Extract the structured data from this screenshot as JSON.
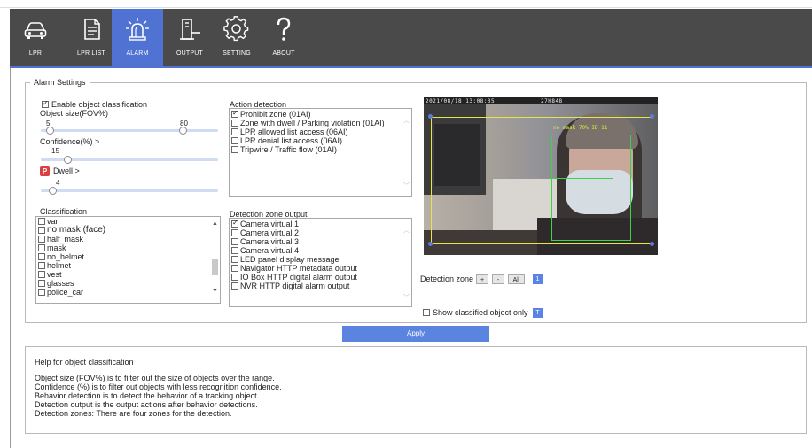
{
  "nav": {
    "items": [
      {
        "label": "LPR",
        "icon": "car-icon"
      },
      {
        "label": "LPR LIST",
        "icon": "document-icon"
      },
      {
        "label": "ALARM",
        "icon": "alarm-siren-icon"
      },
      {
        "label": "OUTPUT",
        "icon": "output-plug-icon"
      },
      {
        "label": "SETTING",
        "icon": "gear-icon"
      },
      {
        "label": "ABOUT",
        "icon": "question-icon"
      }
    ],
    "active": "ALARM",
    "accent": "#4f72d3"
  },
  "alarm": {
    "legend": "Alarm Settings",
    "enable_label": "Enable object classification",
    "enable_checked": true,
    "object_size_label": "Object size(FOV%)",
    "object_size_min": "5",
    "object_size_max": "80",
    "object_size_range": [
      5,
      80
    ],
    "confidence_label": "Confidence(%) >",
    "confidence_value": "15",
    "confidence_level": 15,
    "dwell_badge": "P",
    "dwell_label": "Dwell >",
    "dwell_value": "4",
    "dwell_level": 4,
    "classification_label": "Classification",
    "classification_items": [
      "van",
      "no mask (face)",
      "half_mask",
      "mask",
      "no_helmet",
      "helmet",
      "vest",
      "glasses",
      "police_car"
    ],
    "action_label": "Action detection",
    "action_items": [
      {
        "label": "Prohibit zone (01AI)",
        "checked": true
      },
      {
        "label": "Zone with dwell / Parking violation (01AI)",
        "checked": false
      },
      {
        "label": "LPR allowed list access (06AI)",
        "checked": false
      },
      {
        "label": "LPR denial list access (06AI)",
        "checked": false
      },
      {
        "label": "Tripwire / Traffic flow (01AI)",
        "checked": false
      }
    ],
    "output_label": "Detection zone output",
    "output_items": [
      {
        "label": "Camera virtual 1",
        "checked": true
      },
      {
        "label": "Camera virtual 2",
        "checked": false
      },
      {
        "label": "Camera virtual 3",
        "checked": false
      },
      {
        "label": "Camera virtual 4",
        "checked": false
      },
      {
        "label": "LED panel display message",
        "checked": false
      },
      {
        "label": "Navigator HTTP metadata output",
        "checked": false
      },
      {
        "label": "IO Box HTTP digital alarm output",
        "checked": false
      },
      {
        "label": "NVR HTTP digital alarm output",
        "checked": false
      }
    ],
    "video": {
      "timestamp": "2021/08/18 13:08:35",
      "osd_right": "27H848",
      "bbox_label": "no mask 70% ID 11"
    },
    "zone": {
      "label": "Detection zone",
      "plus": "+",
      "minus": "-",
      "all": "All",
      "number": "1"
    },
    "show_classified_label": "Show classified object only",
    "show_classified_badge": "T",
    "show_classified_checked": false
  },
  "apply_label": "Apply",
  "help": {
    "title": "Help for object classification",
    "lines": [
      "Object size (FOV%) is to filter out the size of objects over the range.",
      "Confidence (%) is to filter out objects with less recognition confidence.",
      "Behavior detection is to detect the behavior of a tracking object.",
      "Detection output is the output actions after behavior detections.",
      "Detection zones: There are four zones for the detection."
    ]
  }
}
